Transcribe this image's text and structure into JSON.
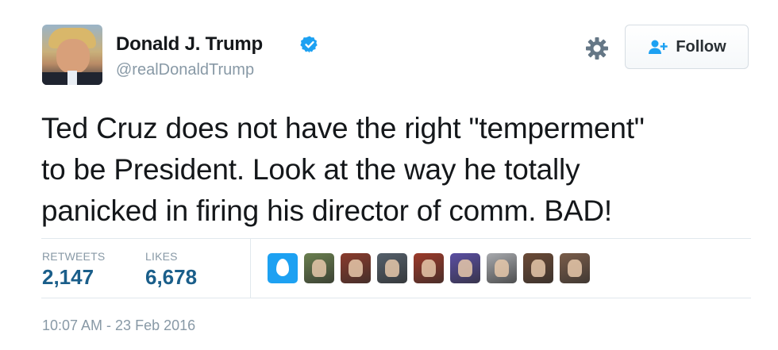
{
  "user": {
    "name": "Donald J. Trump",
    "handle": "@realDonaldTrump",
    "verified": true
  },
  "actions": {
    "follow_label": "Follow"
  },
  "tweet": {
    "lines": [
      "Ted Cruz does not have the right \"temperment\"",
      "to be President. Look at the way he totally",
      "panicked in firing his director of comm. BAD!"
    ]
  },
  "stats": {
    "retweets_label": "RETWEETS",
    "retweets_value": "2,147",
    "likes_label": "LIKES",
    "likes_value": "6,678"
  },
  "likers": [
    {
      "icon": "default-egg-avatar",
      "color": "#1da1f2"
    },
    {
      "icon": "liker-avatar",
      "color": "#6a7f4f"
    },
    {
      "icon": "liker-avatar",
      "color": "#8a3b2c"
    },
    {
      "icon": "liker-avatar",
      "color": "#55606b"
    },
    {
      "icon": "liker-avatar",
      "color": "#9c3a2a"
    },
    {
      "icon": "liker-avatar",
      "color": "#5b4fa3"
    },
    {
      "icon": "liker-avatar",
      "color": "#a7a9ad"
    },
    {
      "icon": "liker-avatar",
      "color": "#6b4a36"
    },
    {
      "icon": "liker-avatar",
      "color": "#7a5d4a"
    }
  ],
  "timestamp": "10:07 AM - 23 Feb 2016",
  "colors": {
    "accent": "#1da1f2",
    "stat_value": "#1a5e8a",
    "muted": "#8899a6"
  }
}
